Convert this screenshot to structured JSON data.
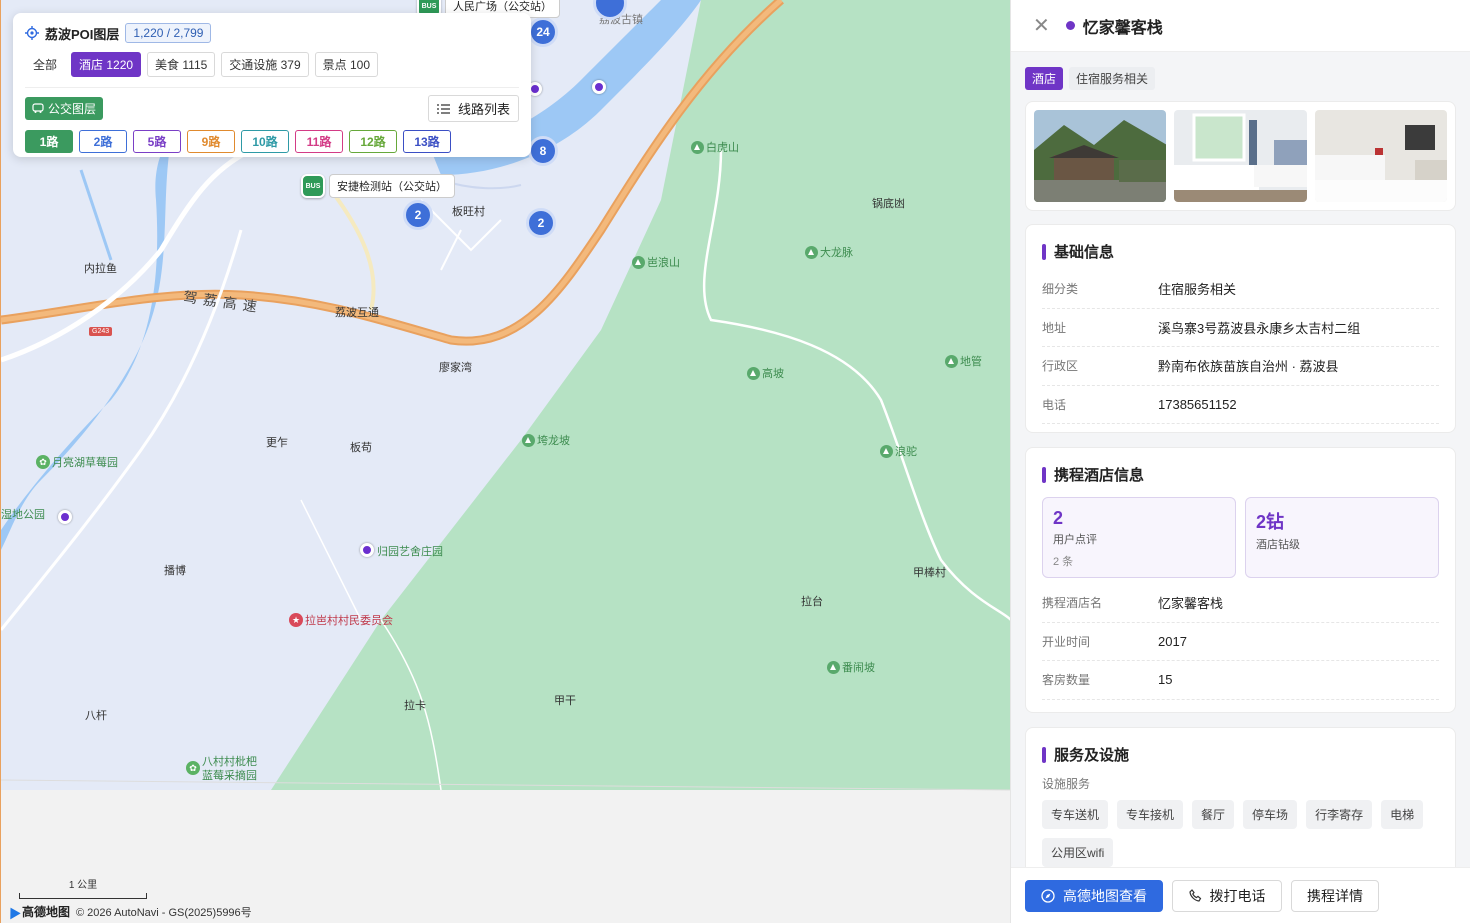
{
  "map": {
    "places": [
      {
        "id": "neilayu",
        "text": "内拉鱼"
      },
      {
        "id": "liaojiawan",
        "text": "廖家湾"
      },
      {
        "id": "gengzuo",
        "text": "更乍"
      },
      {
        "id": "bangou",
        "text": "板苟"
      },
      {
        "id": "bowang",
        "text": "板旺村"
      },
      {
        "id": "guodidang",
        "text": "锅底凼"
      },
      {
        "id": "bobo",
        "text": "播博"
      },
      {
        "id": "bagan",
        "text": "八杆"
      },
      {
        "id": "laka",
        "text": "拉卡"
      },
      {
        "id": "jiagan",
        "text": "甲干"
      },
      {
        "id": "latai",
        "text": "拉台"
      },
      {
        "id": "jiabangcun",
        "text": "甲棒村"
      },
      {
        "id": "libohutong",
        "text": "荔波互通"
      },
      {
        "id": "gushizhen",
        "text": "荔波古镇"
      }
    ],
    "mountains": [
      {
        "id": "baihushan",
        "text": "白虎山"
      },
      {
        "id": "dalongmai",
        "text": "大龙脉"
      },
      {
        "id": "dangliangshan",
        "text": "岜浪山"
      },
      {
        "id": "gaopo",
        "text": "高坡"
      },
      {
        "id": "diguan",
        "text": "地管"
      },
      {
        "id": "kualongpo",
        "text": "垮龙坡"
      },
      {
        "id": "langtuo",
        "text": "浪驼"
      },
      {
        "id": "fannaopo",
        "text": "番闹坡"
      }
    ],
    "pois": [
      {
        "id": "yueliang",
        "text": "月亮湖草莓园"
      },
      {
        "id": "shidi",
        "text": "湿地公园"
      },
      {
        "id": "guiyuan",
        "text": "归园艺舍庄园"
      },
      {
        "id": "ladang",
        "text": "拉岜村村民委员会"
      },
      {
        "id": "bacun",
        "text": "八村村枇杷蓝莓采摘园"
      }
    ],
    "clusters": [
      "24",
      "8",
      "2",
      "2"
    ],
    "bus_stops": [
      {
        "text": "人民广场（公交站）"
      },
      {
        "text": "安捷检测站（公交站）"
      }
    ],
    "bus_badge": "BUS",
    "road_label": "驾荔高速",
    "road_shield": "G243",
    "scale_label": "1 公里",
    "logo": "高德地图",
    "attribution": "© 2026 AutoNavi - GS(2025)5996号"
  },
  "layer": {
    "title": "荔波POI图层",
    "count": "1,220 / 2,799",
    "filters": [
      {
        "label": "全部",
        "state": "plain"
      },
      {
        "label": "酒店 1220",
        "state": "active"
      },
      {
        "label": "美食 1115",
        "state": "normal"
      },
      {
        "label": "交通设施 379",
        "state": "normal"
      },
      {
        "label": "景点 100",
        "state": "normal"
      }
    ],
    "bus_layer": "公交图层",
    "route_list": "线路列表",
    "routes": [
      {
        "label": "1路",
        "color": "#3b9a5f",
        "active": true
      },
      {
        "label": "2路",
        "color": "#3e6fd8",
        "active": false
      },
      {
        "label": "5路",
        "color": "#7a3fc6",
        "active": false
      },
      {
        "label": "9路",
        "color": "#e08a2e",
        "active": false
      },
      {
        "label": "10路",
        "color": "#2e9aa6",
        "active": false
      },
      {
        "label": "11路",
        "color": "#d33b86",
        "active": false
      },
      {
        "label": "12路",
        "color": "#66a83a",
        "active": false
      },
      {
        "label": "13路",
        "color": "#3b4fc4",
        "active": false
      }
    ]
  },
  "panel": {
    "name": "忆家馨客栈",
    "tags": [
      "酒店",
      "住宿服务相关"
    ],
    "basic_title": "基础信息",
    "basic": [
      {
        "k": "细分类",
        "v": "住宿服务相关"
      },
      {
        "k": "地址",
        "v": "溪鸟寨3号荔波县永康乡太吉村二组"
      },
      {
        "k": "行政区",
        "v": "黔南布依族苗族自治州 · 荔波县"
      },
      {
        "k": "电话",
        "v": "17385651152"
      }
    ],
    "ctrip_title": "携程酒店信息",
    "stats": [
      {
        "n": "2",
        "l": "用户点评",
        "s": "2 条"
      },
      {
        "n": "2钻",
        "l": "酒店钻级",
        "s": ""
      }
    ],
    "ctrip": [
      {
        "k": "携程酒店名",
        "v": "忆家馨客栈"
      },
      {
        "k": "开业时间",
        "v": "2017"
      },
      {
        "k": "客房数量",
        "v": "15"
      }
    ],
    "service_title": "服务及设施",
    "service_label": "设施服务",
    "facilities": [
      "专车送机",
      "专车接机",
      "餐厅",
      "停车场",
      "行李寄存",
      "电梯",
      "公用区wifi"
    ],
    "buttons": {
      "map": "高德地图查看",
      "call": "拨打电话",
      "detail": "携程详情"
    }
  }
}
